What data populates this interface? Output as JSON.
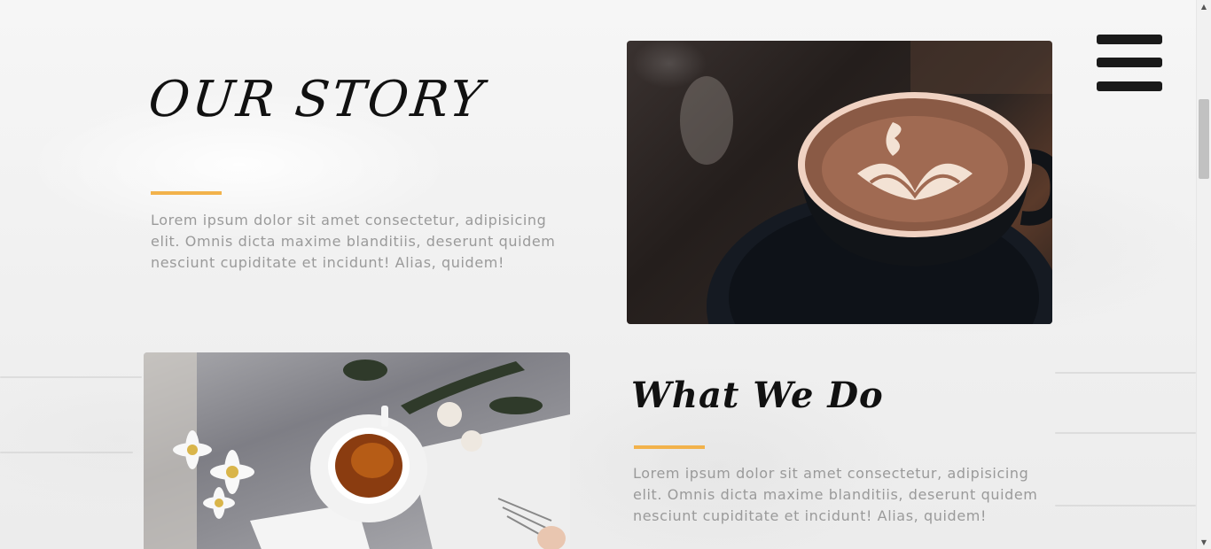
{
  "our_story": {
    "title": "OUR STORY",
    "text": "Lorem ipsum dolor sit amet consectetur, adipisicing elit. Omnis dicta maxime blanditiis, deserunt quidem nesciunt cupiditate et incidunt! Alias, quidem!"
  },
  "what_we_do": {
    "title": "What We Do",
    "text": "Lorem ipsum dolor sit amet consectetur, adipisicing elit. Omnis dicta maxime blanditiis, deserunt quidem nesciunt cupiditate et incidunt! Alias, quidem!"
  },
  "menu": {
    "icon": "hamburger-menu-icon"
  },
  "images": {
    "coffee": "latte-art-cup-image",
    "tea": "tea-cup-flowers-image"
  },
  "colors": {
    "accent": "#f2b24b",
    "text_muted": "#9a9a9a",
    "heading": "#111111"
  },
  "scrollbar": {
    "up_arrow": "▲",
    "down_arrow": "▼"
  }
}
